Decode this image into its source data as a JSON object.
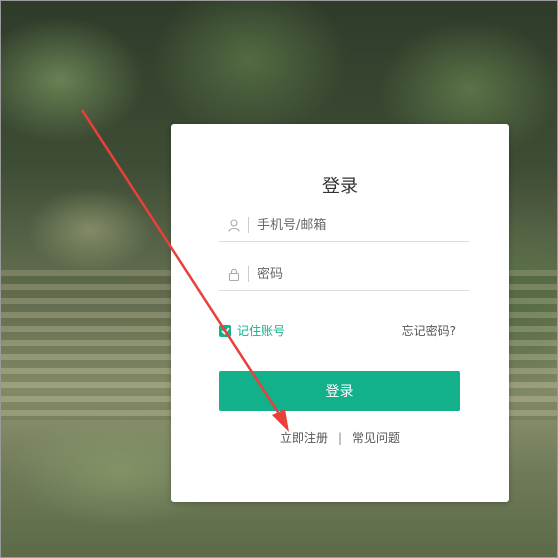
{
  "login": {
    "title": "登录",
    "username_placeholder": "手机号/邮箱",
    "password_placeholder": "密码",
    "remember_label": "记住账号",
    "forgot_label": "忘记密码?",
    "submit_label": "登录",
    "register_link": "立即注册",
    "divider": "|",
    "faq_link": "常见问题"
  },
  "icons": {
    "username": "user-icon",
    "password": "lock-icon",
    "remember": "checkbox-checked-icon"
  },
  "annotation": {
    "type": "arrow",
    "color": "#e8403a",
    "points_to": "立即注册"
  },
  "colors": {
    "accent": "#13b08c",
    "arrow": "#e8403a"
  }
}
